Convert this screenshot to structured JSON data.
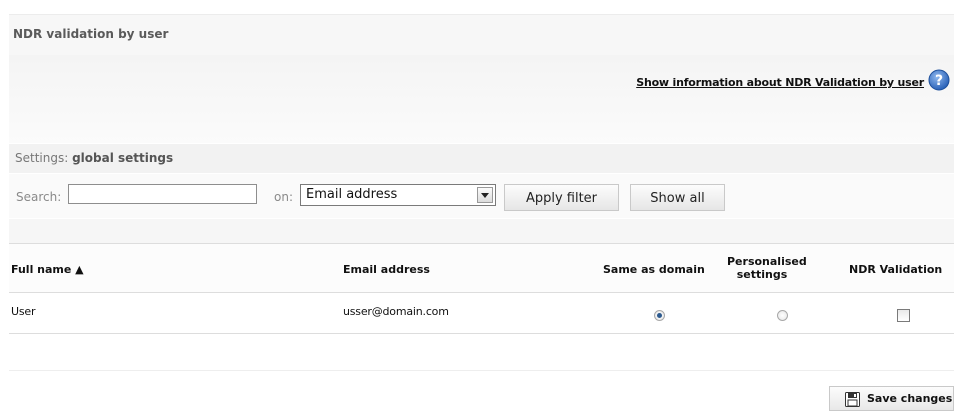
{
  "page": {
    "title": "NDR validation by user",
    "info_link": "Show information about NDR Validation by user"
  },
  "icons": {
    "help": "help-icon",
    "sort": "sort-ascending-icon",
    "save": "floppy-disk-icon"
  },
  "settings": {
    "label": "Settings:",
    "value": "global settings"
  },
  "search": {
    "label": "Search:",
    "value": "",
    "on_label": "on:",
    "field_selected": "Email address",
    "apply_label": "Apply filter",
    "show_all_label": "Show all"
  },
  "table": {
    "columns": [
      "Full name ▲",
      "Email address",
      "Same as domain",
      "Personalised settings",
      "NDR Validation"
    ],
    "rows": [
      {
        "full_name": "User",
        "email": "usser@domain.com",
        "same_as_domain": true,
        "personalised_settings": false,
        "ndr_validation": false
      }
    ]
  },
  "footer": {
    "save_label": "Save changes"
  },
  "colors": {
    "accent": "#2d5a8e",
    "help_icon": "#3a74c9"
  }
}
